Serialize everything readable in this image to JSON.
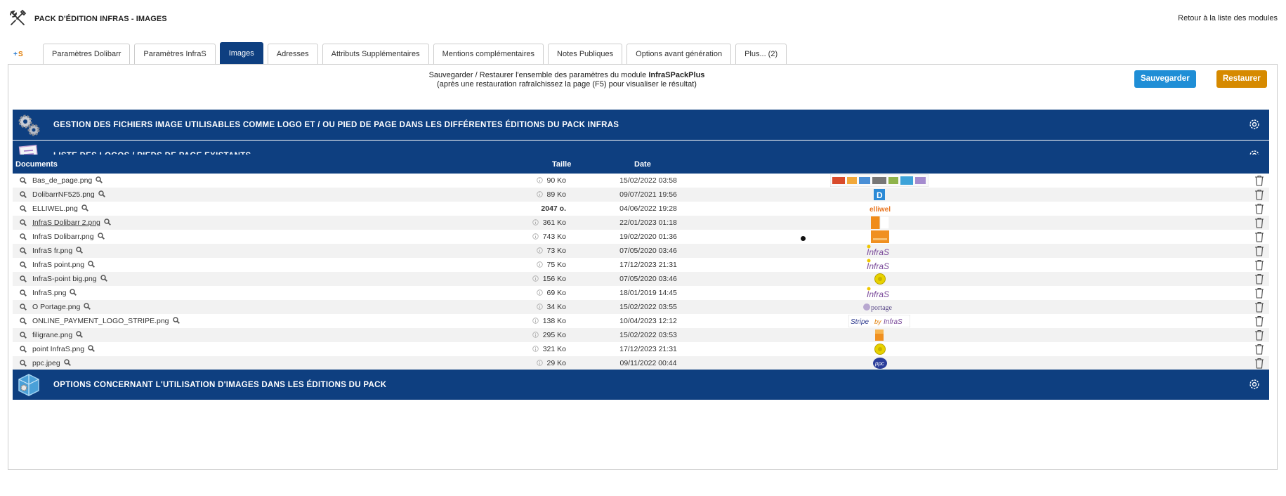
{
  "header": {
    "title": "PACK D'ÉDITION INFRAS - IMAGES",
    "back_link": "Retour à la liste des modules"
  },
  "tabs": [
    {
      "label": "Paramètres Dolibarr"
    },
    {
      "label": "Paramètres InfraS"
    },
    {
      "label": "Images",
      "active": true
    },
    {
      "label": "Adresses"
    },
    {
      "label": "Attributs Supplémentaires"
    },
    {
      "label": "Mentions complémentaires"
    },
    {
      "label": "Notes Publiques"
    },
    {
      "label": "Options avant génération"
    },
    {
      "label": "Plus... (2)"
    }
  ],
  "backup": {
    "line1_prefix": "Sauvegarder / Restaurer l'ensemble des paramètres du module ",
    "module_name": "InfraSPackPlus",
    "line2": "(après une restauration rafraîchissez la page (F5) pour visualiser le résultat)",
    "save_label": "Sauvegarder",
    "restore_label": "Restaurer"
  },
  "sections": {
    "s1": "GESTION DES FICHIERS IMAGE UTILISABLES COMME LOGO ET / OU PIED DE PAGE DANS LES DIFFÉRENTES ÉDITIONS DU PACK INFRAS",
    "s2": "LISTE DES LOGOS / PIEDS DE PAGE EXISTANTS",
    "s3": "OPTIONS CONCERNANT L'UTILISATION D'IMAGES DANS LES ÉDITIONS DU PACK"
  },
  "table": {
    "headers": {
      "documents": "Documents",
      "size": "Taille",
      "date": "Date"
    },
    "rows": [
      {
        "name": "Bas_de_page.png",
        "size": "90 Ko",
        "date": "15/02/2022 03:58",
        "info": true,
        "thumb": "banner"
      },
      {
        "name": "DolibarrNF525.png",
        "size": "89 Ko",
        "date": "09/07/2021 19:56",
        "info": true,
        "thumb": "dolibarr"
      },
      {
        "name": "ELLIWEL.png",
        "size": "2047 o.",
        "date": "04/06/2022 19:28",
        "info": false,
        "thumb": "elliwel"
      },
      {
        "name": "InfraS Dolibarr 2.png",
        "size": "361 Ko",
        "date": "22/01/2023 01:18",
        "info": true,
        "thumb": "orange-half",
        "link": true
      },
      {
        "name": "InfraS Dolibarr.png",
        "size": "743 Ko",
        "date": "19/02/2020 01:36",
        "info": true,
        "thumb": "orange"
      },
      {
        "name": "InfraS fr.png",
        "size": "73 Ko",
        "date": "07/05/2020 03:46",
        "info": true,
        "thumb": "infras"
      },
      {
        "name": "InfraS point.png",
        "size": "75 Ko",
        "date": "17/12/2023 21:31",
        "info": true,
        "thumb": "infras"
      },
      {
        "name": "InfraS-point big.png",
        "size": "156 Ko",
        "date": "07/05/2020 03:46",
        "info": true,
        "thumb": "yellow"
      },
      {
        "name": "InfraS.png",
        "size": "69 Ko",
        "date": "18/01/2019 14:45",
        "info": true,
        "thumb": "infras"
      },
      {
        "name": "O Portage.png",
        "size": "34 Ko",
        "date": "15/02/2022 03:55",
        "info": true,
        "thumb": "portage"
      },
      {
        "name": "ONLINE_PAYMENT_LOGO_STRIPE.png",
        "size": "138 Ko",
        "date": "10/04/2023 12:12",
        "info": true,
        "thumb": "stripe"
      },
      {
        "name": "filigrane.png",
        "size": "295 Ko",
        "date": "15/02/2022 03:53",
        "info": true,
        "thumb": "orange-small"
      },
      {
        "name": "point InfraS.png",
        "size": "321 Ko",
        "date": "17/12/2023 21:31",
        "info": true,
        "thumb": "yellow"
      },
      {
        "name": "ppc.jpeg",
        "size": "29 Ko",
        "date": "09/11/2022 00:44",
        "info": true,
        "thumb": "ppc"
      }
    ]
  },
  "thumb_text": {
    "elliwel": "elliwel",
    "infras": "InfraS",
    "portage": "portage",
    "stripe_a": "Stripe",
    "stripe_b": "by",
    "stripe_c": "InfraS",
    "ppc": "ppc"
  },
  "colors": {
    "brand_blue": "#0e3f80",
    "save_button": "#1f8ed6",
    "restore_button": "#d68a00"
  }
}
